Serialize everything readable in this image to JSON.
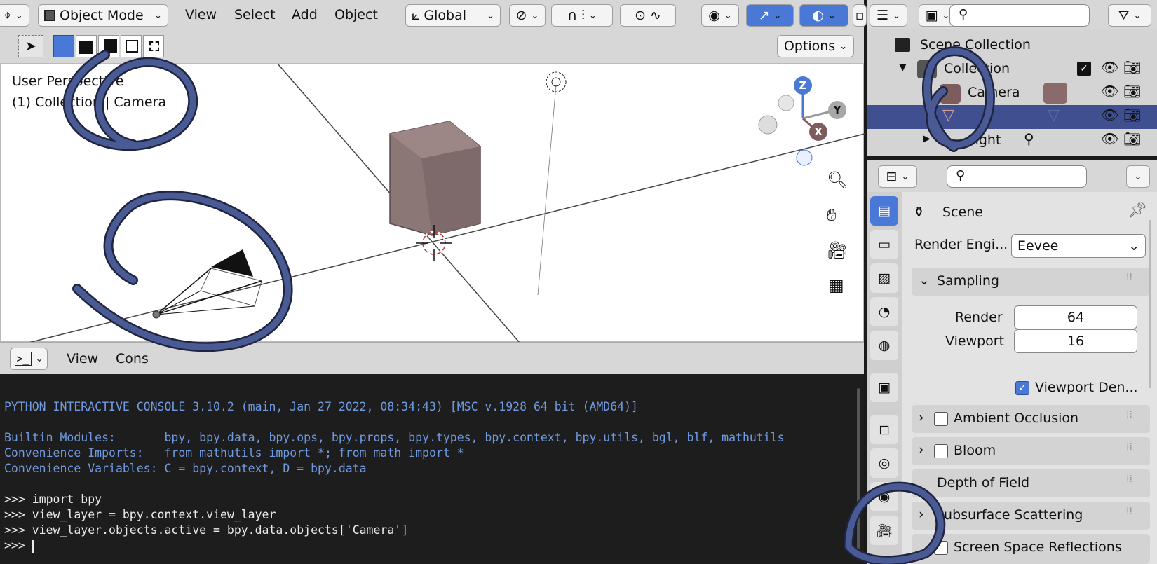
{
  "header": {
    "mode_label": "Object Mode",
    "menu_view": "View",
    "menu_select": "Select",
    "menu_add": "Add",
    "menu_object": "Object",
    "orientation_label": "Global"
  },
  "toolbar": {
    "options_label": "Options"
  },
  "viewport": {
    "perspective_label": "User Perspective",
    "collection_label": "(1) Collection | Camera",
    "gizmo_z": "Z",
    "gizmo_y": "Y",
    "gizmo_x": "X"
  },
  "console_header": {
    "menu_view": "View",
    "menu_console": "Cons"
  },
  "console": {
    "lines": [
      "PYTHON INTERACTIVE CONSOLE 3.10.2 (main, Jan 27 2022, 08:34:43) [MSC v.1928 64 bit (AMD64)]",
      "Builtin Modules:       bpy, bpy.data, bpy.ops, bpy.props, bpy.types, bpy.context, bpy.utils, bgl, blf, mathutils",
      "Convenience Imports:   from mathutils import *; from math import *",
      "Convenience Variables: C = bpy.context, D = bpy.data",
      ">>> import bpy",
      ">>> view_layer = bpy.context.view_layer",
      ">>> view_layer.objects.active = bpy.data.objects['Camera']",
      ">>> "
    ]
  },
  "outliner": {
    "scene_collection": "Scene Collection",
    "collection": "Collection",
    "camera": "Camera",
    "cube": "Cube",
    "light": "Light"
  },
  "properties": {
    "context_label": "Scene",
    "render_engine_label": "Render Engi...",
    "render_engine_value": "Eevee",
    "sampling_label": "Sampling",
    "render_label": "Render",
    "render_value": "64",
    "viewport_label": "Viewport",
    "viewport_value": "16",
    "viewport_denoise_label": "Viewport Den...",
    "panels": [
      "Ambient Occlusion",
      "Bloom",
      "Depth of Field",
      "Subsurface Scattering",
      "Screen Space Reflections"
    ]
  },
  "colors": {
    "accent_blue": "#4a78d6",
    "annotation_stroke": "#4a5a94",
    "selected_row": "#3f4f8f",
    "console_bg": "#1d1d1d",
    "console_text_blue": "#6f9ae0"
  }
}
